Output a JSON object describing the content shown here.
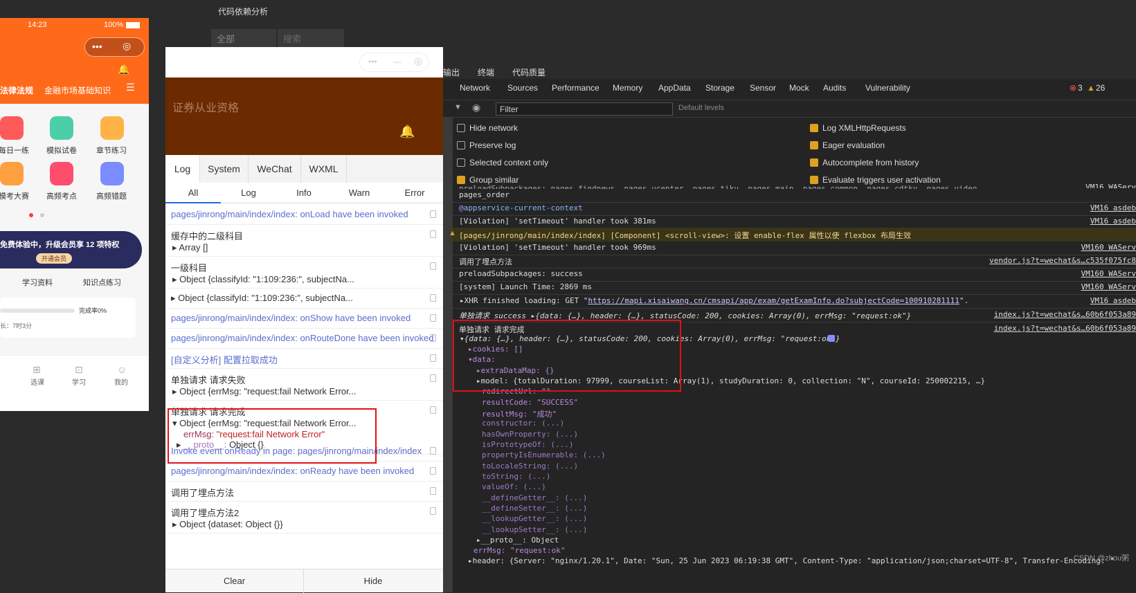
{
  "phone": {
    "time": "14:23",
    "battery": "100%",
    "menu_glyph": "•••",
    "target_glyph": "◎",
    "nav_tabs": [
      "法律法规",
      "金融市场基础知识"
    ],
    "grid": [
      "每日一练",
      "模拟试卷",
      "章节练习",
      "模考大赛",
      "高频考点",
      "高频错题"
    ],
    "banner": "免费体验中，升级会员享 12 项特权",
    "banner_btn": "开通会员",
    "links": [
      "学习资料",
      "知识点练习"
    ],
    "progress": "完成率0%",
    "duration": "长：7时3分",
    "bottom_nav": [
      "选课",
      "学习",
      "我的"
    ]
  },
  "context": {
    "title": "代码依赖分析",
    "select": "全部",
    "search_placeholder": "搜索"
  },
  "vconsole": {
    "header_title": "证券从业资格",
    "tabs": [
      "Log",
      "System",
      "WeChat",
      "WXML"
    ],
    "sub_tabs": [
      "All",
      "Log",
      "Info",
      "Warn",
      "Error"
    ],
    "rows": [
      {
        "l1": "pages/jinrong/main/index/index: onLoad have been invoked"
      },
      {
        "l1": "缓存中的二级科目",
        "l2": "Array []"
      },
      {
        "l1": "一级科目",
        "l2": "Object {classifyId: \"1:109:236:\", subjectNa..."
      },
      {
        "l1": "Object {classifyId: \"1:109:236:\", subjectNa..."
      },
      {
        "l1": "pages/jinrong/main/index/index: onShow have been invoked"
      },
      {
        "l1": "pages/jinrong/main/index/index: onRouteDone have been invoked"
      },
      {
        "l1": "[自定义分析] 配置拉取成功"
      },
      {
        "l1": "单独请求 请求失败",
        "l2": "Object {errMsg: \"request:fail Network Error..."
      },
      {
        "l1": "单独请求 请求完成",
        "l2": "Object {errMsg: \"request:fail Network Error...",
        "l3k": "errMsg:",
        "l3v": "\"request:fail Network Error\"",
        "l4k": "__proto__:",
        "l4v": "Object {}"
      },
      {
        "l1": "Invoke event onReady in page: pages/jinrong/main/index/index"
      },
      {
        "l1": "pages/jinrong/main/index/index: onReady have been invoked"
      },
      {
        "l1": "调用了埋点方法"
      },
      {
        "l1": "调用了埋点方法2",
        "l2": "Object {dataset: Object {}}"
      }
    ],
    "footer": [
      "Clear",
      "Hide"
    ]
  },
  "devtools": {
    "top_tabs": [
      "输出",
      "终端",
      "代码质量"
    ],
    "tabs": [
      "Network",
      "Sources",
      "Performance",
      "Memory",
      "AppData",
      "Storage",
      "Sensor",
      "Mock",
      "Audits",
      "Vulnerability"
    ],
    "errors": "3",
    "warnings": "26",
    "filter_placeholder": "Filter",
    "levels": "Default levels",
    "left_opts": [
      {
        "label": "Hide network",
        "on": false
      },
      {
        "label": "Preserve log",
        "on": false
      },
      {
        "label": "Selected context only",
        "on": false
      },
      {
        "label": "Group similar",
        "on": true
      }
    ],
    "right_opts": [
      {
        "label": "Log XMLHttpRequests",
        "on": true
      },
      {
        "label": "Eager evaluation",
        "on": true
      },
      {
        "label": "Autocomplete from history",
        "on": true
      },
      {
        "label": "Evaluate triggers user activation",
        "on": true
      }
    ],
    "lines": [
      {
        "t": "preloadSubpackages: pages_findnews, pages_ucenter, pages_tiku, pages_main, pages_common, pages_cdtky, pages_video",
        "r": "VM16 WAServ"
      },
      {
        "t": "pages_order"
      },
      {
        "t": "@appservice-current-context",
        "r": "VM16 asdeb"
      },
      {
        "t": "[Violation] 'setTimeout' handler took 381ms",
        "r": "VM16 asdeb"
      },
      {
        "t": "[pages/jinrong/main/index/index] [Component] <scroll-view>: 设置 enable-flex 属性以使 flexbox 布局生效"
      },
      {
        "t": "[Violation] 'setTimeout' handler took 969ms",
        "r": "VM160 WAServ"
      },
      {
        "t": "调用了埋点方法",
        "r": "vendor.js?t=wechat&s…c535f075fc8"
      },
      {
        "t": "preloadSubpackages: success",
        "r": "VM160 WAServ"
      },
      {
        "t": "[system] Launch Time: 2869 ms",
        "r": "VM160 WAServ"
      },
      {
        "t": "▸XHR finished loading: GET \"",
        "url": "https://mapi.xisaiwang.cn/cmsapi/app/exam/getExamInfo.do?subjectCode=100910281111",
        "t2": "\".",
        "r": "VM16 asdeb"
      },
      {
        "t": "单独请求 success ▸{data: {…}, header: {…}, statusCode: 200, cookies: Array(0), errMsg: \"request:ok\"}",
        "r": "index.js?t=wechat&s…60b6f053a89"
      },
      {
        "t": "单独请求 请求完成",
        "r": "index.js?t=wechat&s…60b6f053a89"
      }
    ],
    "tree": [
      "▾{data: {…}, header: {…}, statusCode: 200, cookies: Array(0), errMsg: \"request:ok\"}",
      "▸cookies: []",
      "▾data:",
      "▸extraDataMap: {}",
      "▸model: {totalDuration: 97999, courseList: Array(1), studyDuration: 0, collection: \"N\", courseId: 250002215, …}",
      "redirectUrl: \"\"",
      "resultCode: \"SUCCESS\"",
      "resultMsg: \"成功\"",
      "constructor: (...)",
      "hasOwnProperty: (...)",
      "isPrototypeOf: (...)",
      "propertyIsEnumerable: (...)",
      "toLocaleString: (...)",
      "toString: (...)",
      "valueOf: (...)",
      "__defineGetter__: (...)",
      "__defineSetter__: (...)",
      "__lookupGetter__: (...)",
      "__lookupSetter__: (...)",
      "▸__proto__: Object",
      "errMsg: \"request:ok\"",
      "▸header: {Server: \"nginx/1.20.1\", Date: \"Sun, 25 Jun 2023 06:19:38 GMT\", Content-Type: \"application/json;charset=UTF-8\", Transfer-Encoding: \""
    ],
    "watermark": "CSDN @zhou粥"
  }
}
